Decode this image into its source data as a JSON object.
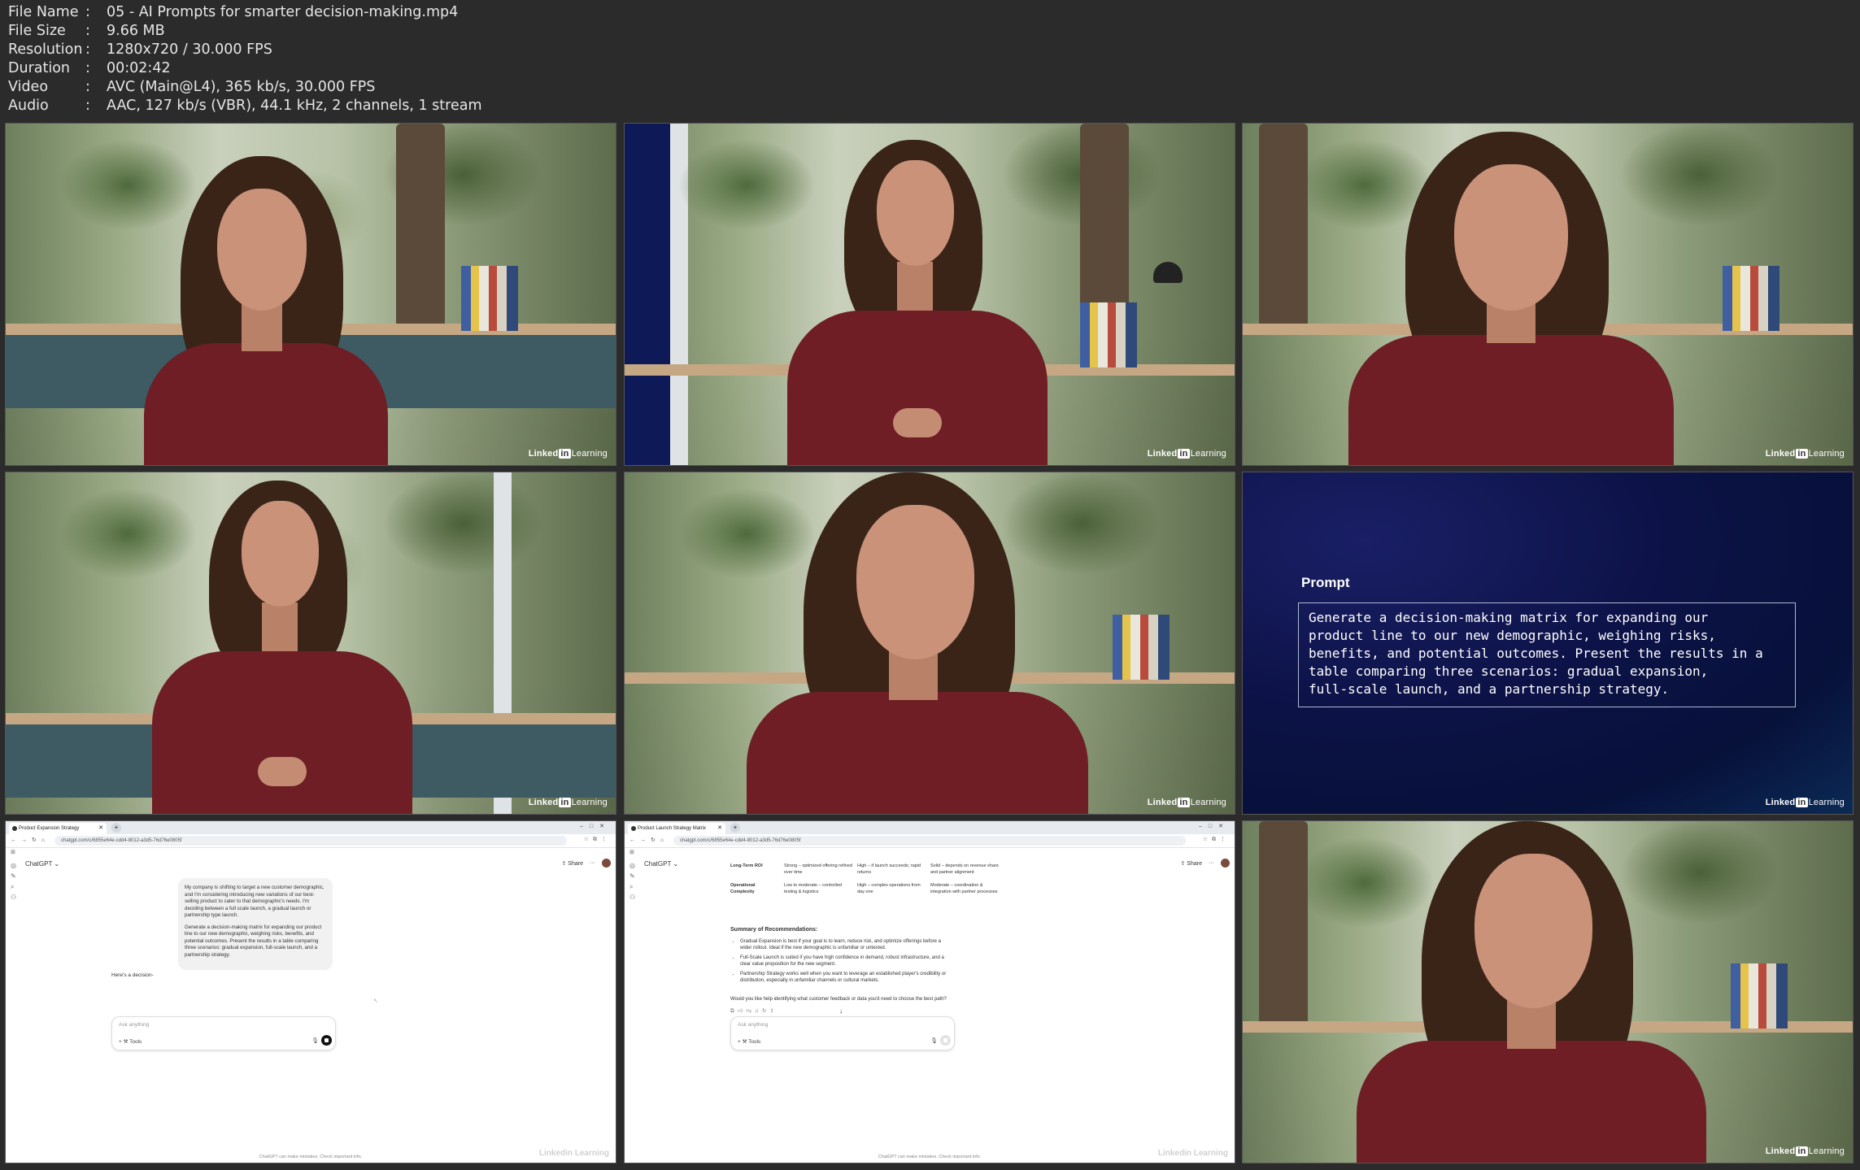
{
  "file_info": {
    "rows": [
      {
        "key": "File Name",
        "sep": ":",
        "value": "05 - AI Prompts for smarter decision-making.mp4"
      },
      {
        "key": "File Size",
        "sep": ":",
        "value": "9.66 MB"
      },
      {
        "key": "Resolution",
        "sep": ":",
        "value": "1280x720 / 30.000 FPS"
      },
      {
        "key": "Duration",
        "sep": ":",
        "value": "00:02:42"
      },
      {
        "key": "Video",
        "sep": ":",
        "value": "AVC (Main@L4), 365 kb/s, 30.000 FPS"
      },
      {
        "key": "Audio",
        "sep": ":",
        "value": "AAC, 127 kb/s (VBR), 44.1 kHz, 2 channels, 1 stream"
      }
    ]
  },
  "watermark": {
    "linked": "Linked",
    "in": "in",
    "learning": "Learning"
  },
  "prompt_slide": {
    "title": "Prompt",
    "lines": [
      "Generate a decision-making matrix for expanding our",
      "product line to our new demographic, weighing risks,",
      "benefits, and potential outcomes. Present the results in a",
      "table comparing three scenarios: gradual expansion,",
      "full-scale launch, and a partnership strategy."
    ]
  },
  "chat1": {
    "tab_title": "Product Expansion Strategy",
    "url": "chatgpt.com/c/6855e64e-cdd4-8012-a3d5-76d76e0805f",
    "app_title": "ChatGPT ⌄",
    "share": "⇪ Share",
    "more": "···",
    "user_msg_p1": "My company is shifting to target a new customer demographic, and I'm considering introducing new variations of our best-selling product to cater to that demographic's needs. I'm deciding between a full scale launch, a gradual launch or partnership type launch.",
    "user_msg_p2": "Generate a decision-making matrix for expanding our product line to our new demographic, weighing risks, benefits, and potential outcomes. Present the results in a table comparing three scenarios: gradual expansion, full-scale launch, and a partnership strategy.",
    "assistant_msg": "Here's a decision-",
    "composer_placeholder": "Ask anything",
    "tools_label": "+   ⚒ Tools",
    "disclaimer": "ChatGPT can make mistakes. Check important info."
  },
  "chat2": {
    "tab_title": "Product Launch Strategy Matrix",
    "url": "chatgpt.com/c/6855e64e-cdd4-8012-a3d5-76d76e0805f",
    "app_title": "ChatGPT ⌄",
    "share": "⇪ Share",
    "more": "···",
    "rows": [
      {
        "c1": "Long-Term ROI",
        "c2": "Strong – optimized offering refined over time",
        "c3": "High – if launch succeeds; rapid returns",
        "c4": "Solid – depends on revenue share and partner alignment"
      },
      {
        "c1": "Operational Complexity",
        "c2": "Low to moderate – controlled testing & logistics",
        "c3": "High – complex operations from day one",
        "c4": "Moderate – coordination & integration with partner processes"
      }
    ],
    "summary_title": "Summary of Recommendations:",
    "summary_items": [
      "Gradual Expansion is best if your goal is to learn, reduce risk, and optimize offerings before a wider rollout. Ideal if the new demographic is unfamiliar or untested.",
      "Full-Scale Launch is suited if you have high confidence in demand, robust infrastructure, and a clear value proposition for the new segment.",
      "Partnership Strategy works well when you want to leverage an established player's credibility or distribution, especially in unfamiliar channels or cultural markets."
    ],
    "followup": "Would you like help identifying what customer feedback or data you'd need to choose the best path?",
    "composer_placeholder": "Ask anything",
    "tools_label": "+   ⚒ Tools",
    "disclaimer": "ChatGPT can make mistakes. Check important info."
  }
}
